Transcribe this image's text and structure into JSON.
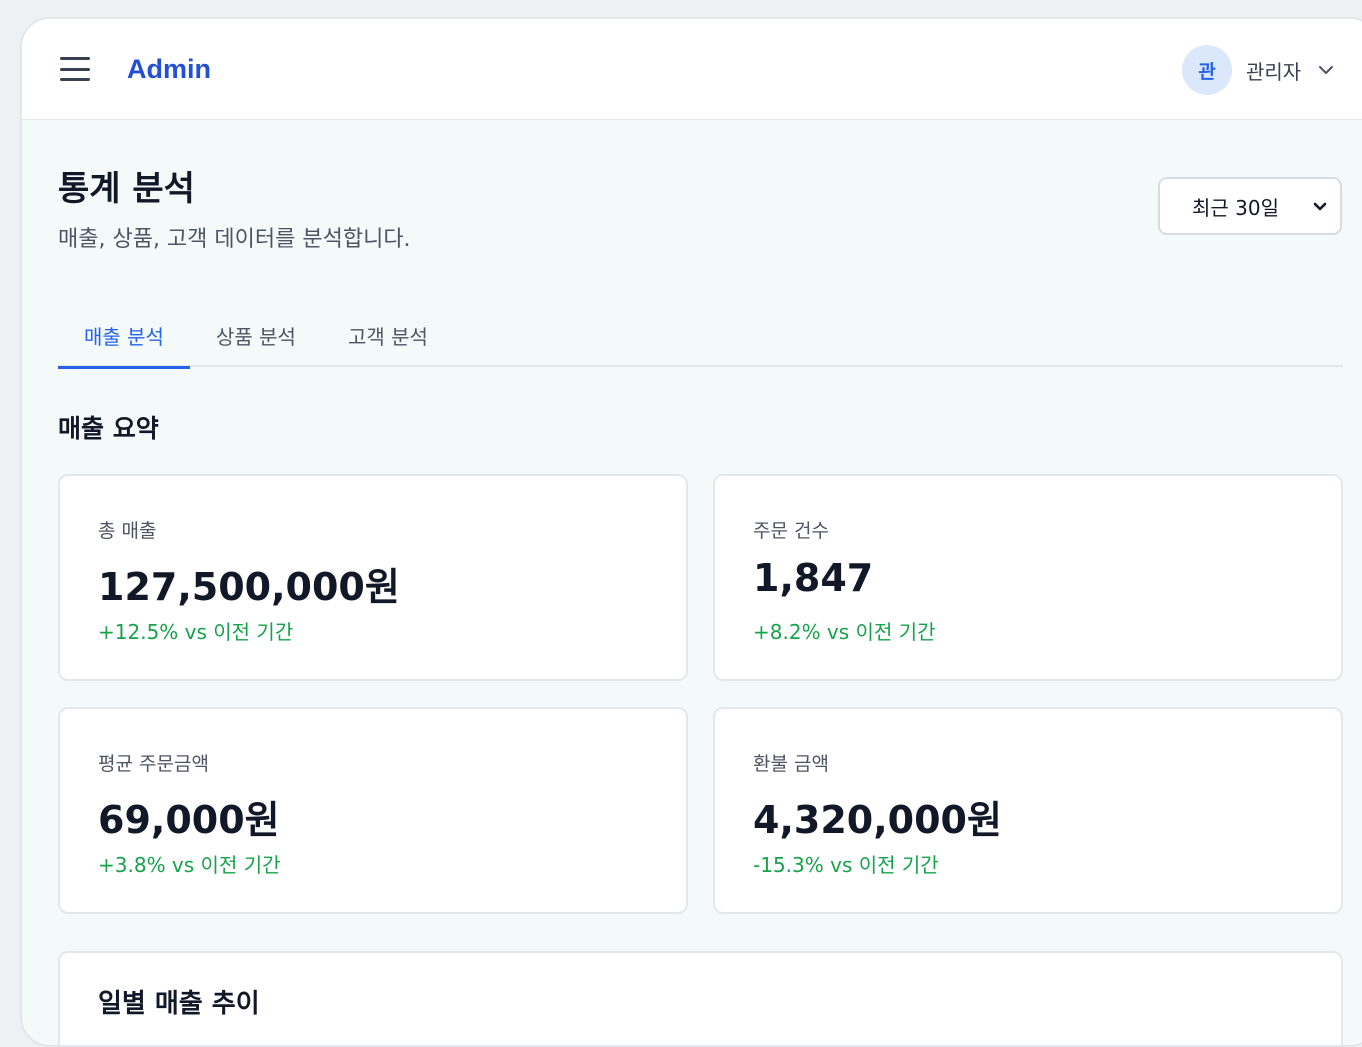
{
  "header": {
    "brand": "Admin",
    "user": {
      "avatar_initial": "관",
      "name": "관리자"
    }
  },
  "page": {
    "title": "통계 분석",
    "subtitle": "매출, 상품, 고객 데이터를 분석합니다.",
    "period_selected": "최근 30일"
  },
  "tabs": [
    {
      "label": "매출 분석",
      "active": true
    },
    {
      "label": "상품 분석",
      "active": false
    },
    {
      "label": "고객 분석",
      "active": false
    }
  ],
  "summary": {
    "title": "매출 요약",
    "cards": [
      {
        "label": "총 매출",
        "value": "127,500,000원",
        "change": "+12.5% vs 이전 기간"
      },
      {
        "label": "주문 건수",
        "value": "1,847",
        "change": "+8.2% vs 이전 기간"
      },
      {
        "label": "평균 주문금액",
        "value": "69,000원",
        "change": "+3.8% vs 이전 기간"
      },
      {
        "label": "환불 금액",
        "value": "4,320,000원",
        "change": "-15.3% vs 이전 기간"
      }
    ]
  },
  "chart_section": {
    "title": "일별 매출 추이"
  },
  "colors": {
    "brand": "#2150d4",
    "accent": "#2563eb",
    "positive": "#16a34a"
  }
}
